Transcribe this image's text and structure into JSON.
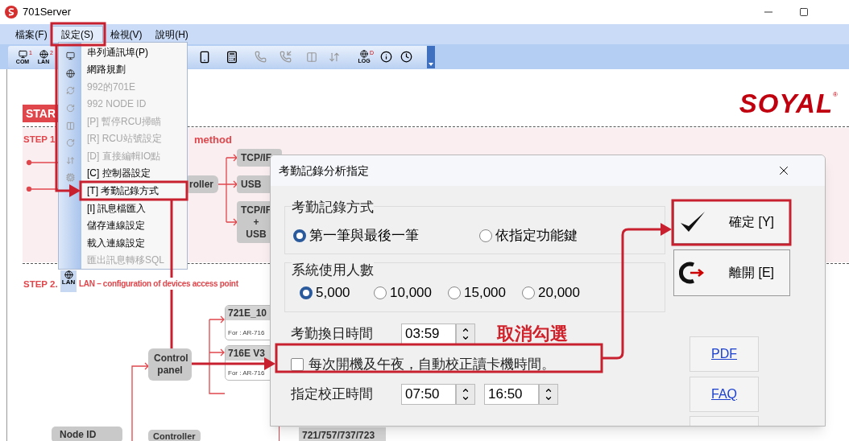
{
  "window": {
    "title": "701Server"
  },
  "menu_bar": [
    {
      "label": "檔案(F)",
      "selected": false
    },
    {
      "label": "設定(S)",
      "selected": true
    },
    {
      "label": "檢視(V)",
      "selected": false
    },
    {
      "label": "說明(H)",
      "selected": false
    }
  ],
  "toolbar": {
    "left": [
      {
        "label": "COM",
        "badge": "1"
      },
      {
        "label": "LAN",
        "badge": "2"
      }
    ],
    "log": {
      "label": "LOG",
      "badge": "D"
    }
  },
  "settings_menu": [
    {
      "label": "串列通訊埠(P)",
      "disabled": false
    },
    {
      "label": "網路規劃",
      "disabled": false
    },
    {
      "label": "992的701E",
      "disabled": true
    },
    {
      "label": "992 NODE ID",
      "disabled": true
    },
    {
      "label": "[P] 暫停RCU掃瞄",
      "disabled": true
    },
    {
      "label": "[R] RCU站號設定",
      "disabled": true
    },
    {
      "label": "[D] 直接編輯IO點",
      "disabled": true
    },
    {
      "label": "[C] 控制器設定",
      "disabled": false
    },
    {
      "label": "[T] 考勤記錄方式",
      "disabled": false
    },
    {
      "label": "[I] 訊息檔匯入",
      "disabled": false
    },
    {
      "label": "儲存連線設定",
      "disabled": false
    },
    {
      "label": "載入連線設定",
      "disabled": false
    },
    {
      "label": "匯出訊息轉移SQL",
      "disabled": true
    }
  ],
  "guide": {
    "logo": "SOYAL",
    "logo_mark": "®",
    "start": "STAR",
    "step1": "STEP 1",
    "step1_tail": "method",
    "controller": "roller",
    "connections": [
      "TCP/IF",
      "USB"
    ],
    "combo": [
      "TCP/IF",
      "+",
      "USB"
    ],
    "step2": "STEP 2.",
    "step2_icon_label": "LAN",
    "step2_text": "LAN – configuration of devices access point",
    "devices": [
      {
        "name": "721E_10",
        "note": "For : AR-716"
      },
      {
        "name": "716E V3",
        "note": "For : AR-716"
      }
    ],
    "control_panel": "Control panel",
    "node_id": "Node ID",
    "controller_bottom": "Controller",
    "models": "721/757/737/723"
  },
  "dialog": {
    "title": "考勤記錄分析指定",
    "attendance_mode": {
      "label": "考勤記錄方式",
      "options": [
        {
          "label": "第一筆與最後一筆",
          "selected": true
        },
        {
          "label": "依指定功能鍵",
          "selected": false
        }
      ]
    },
    "user_count": {
      "label": "系統使用人數",
      "options": [
        {
          "label": "5,000",
          "selected": true
        },
        {
          "label": "10,000",
          "selected": false
        },
        {
          "label": "15,000",
          "selected": false
        },
        {
          "label": "20,000",
          "selected": false
        }
      ]
    },
    "day_change": {
      "label": "考勤換日時間",
      "value": "03:59"
    },
    "auto_sync": {
      "label": "每次開機及午夜，自動校正讀卡機時間。",
      "checked": false
    },
    "sync_time": {
      "label": "指定校正時間",
      "values": [
        "07:50",
        "16:50"
      ]
    },
    "buttons": [
      {
        "kind": "ok",
        "label": "確定 [Y]"
      },
      {
        "kind": "exit",
        "label": "離開 [E]"
      }
    ],
    "links": [
      "PDF",
      "FAQ"
    ]
  },
  "annotation_note": "取消勾選"
}
